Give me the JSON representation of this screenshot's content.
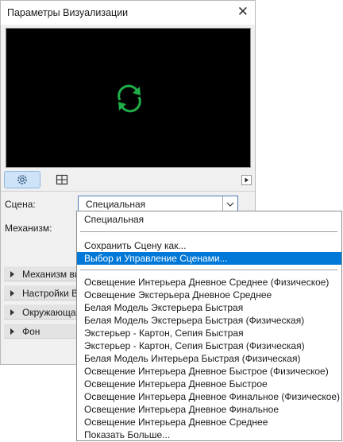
{
  "window": {
    "title": "Параметры Визуализации"
  },
  "tabs": [
    "settings-tab",
    "layout-tab"
  ],
  "scene": {
    "label": "Сцена:",
    "value": "Специальная"
  },
  "engine": {
    "label": "Механизм:"
  },
  "sections": [
    {
      "label": "Механизм ви"
    },
    {
      "label": "Настройки Ви"
    },
    {
      "label": "Окружающая"
    },
    {
      "label": "Фон"
    }
  ],
  "dropdown": {
    "items": [
      "Специальная",
      "Сохранить Сцену как...",
      "Выбор и Управление Сценами...",
      "Освещение Интерьера Дневное Среднее (Физическое)",
      "Освещение Экстерьера Дневное Среднее",
      "Белая Модель Экстерьера Быстрая",
      "Белая Модель Экстерьера Быстрая (Физическая)",
      "Экстерьер - Картон, Сепия Быстрая",
      "Экстерьер - Картон, Сепия Быстрая (Физическая)",
      "Белая Модель Интерьера Быстрая (Физическая)",
      "Освещение Интерьера Дневное Быстрое (Физическое)",
      "Освещение Интерьера Дневное Быстрое",
      "Освещение Интерьера Дневное Финальное (Физическое)",
      "Освещение Интерьера Дневное Финальное",
      "Освещение Интерьера Дневное Среднее",
      "Показать Больше..."
    ],
    "highlighted_index": 2
  },
  "colors": {
    "accent": "#0078d7",
    "refresh_icon": "#1fae4a",
    "preview_bg": "#000000"
  }
}
